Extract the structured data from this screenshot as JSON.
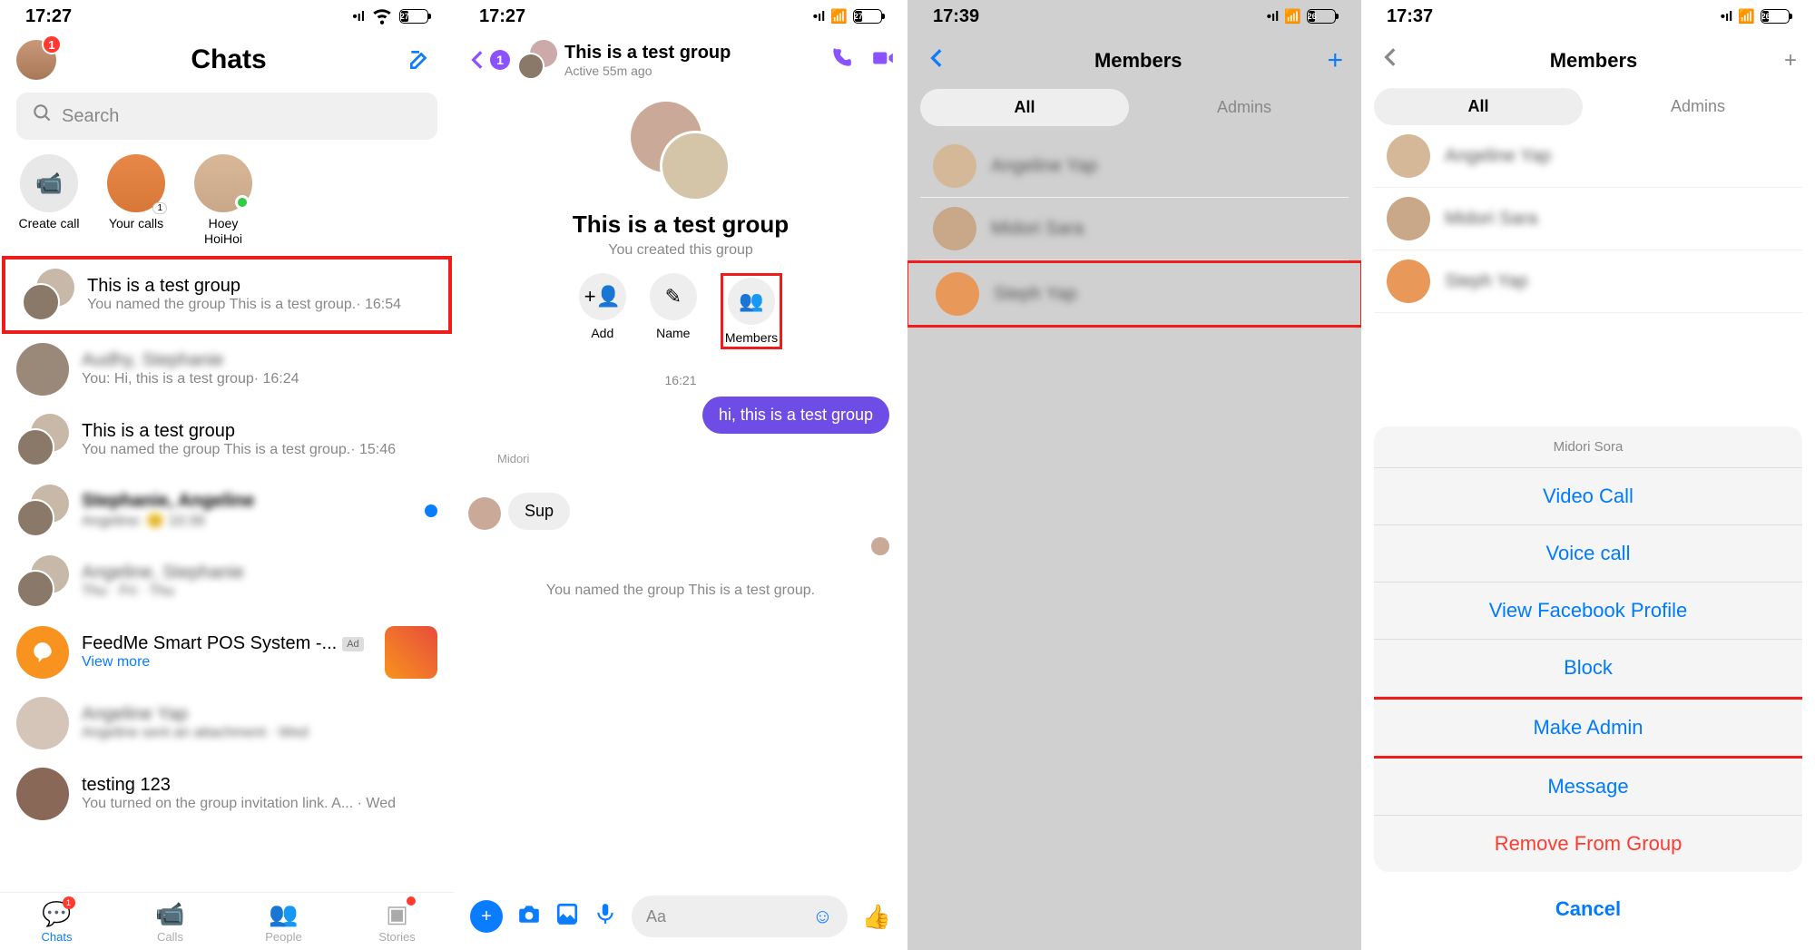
{
  "panel1": {
    "time": "17:27",
    "battery": "27",
    "avatar_badge": "1",
    "title": "Chats",
    "search_placeholder": "Search",
    "stories": [
      {
        "label": "Create call"
      },
      {
        "label": "Your calls",
        "count": "1"
      },
      {
        "label": "Hoey HoiHoi",
        "online": true
      }
    ],
    "chats": [
      {
        "name": "This is a test group",
        "sub": "You named the group This is a test group.· 16:54",
        "highlight": true
      },
      {
        "name": "Audhy, Stephanie",
        "sub": "You: Hi, this is a test group· 16:24",
        "blurred": true
      },
      {
        "name": "This is a test group",
        "sub": "You named the group This is a test group.· 15:46"
      },
      {
        "name": "Stephanie, Angeline",
        "sub": "Angeline: 😊 10:39",
        "unread": true,
        "blurred": true
      },
      {
        "name": "Angeline, Stephanie",
        "sub": "Thu · Fri · Thu",
        "blurred": true
      }
    ],
    "ad": {
      "title": "FeedMe Smart POS System -...",
      "badge": "Ad",
      "view_more": "View more"
    },
    "more_chats": [
      {
        "name": "Angeline Yap",
        "sub": "Angeline sent an attachment · Wed",
        "blurred": true
      },
      {
        "name": "testing 123",
        "sub": "You turned on the group invitation link. A... · Wed"
      }
    ],
    "nav": [
      {
        "label": "Chats",
        "badge": "1",
        "active": true
      },
      {
        "label": "Calls"
      },
      {
        "label": "People"
      },
      {
        "label": "Stories",
        "dot": true
      }
    ]
  },
  "panel2": {
    "time": "17:27",
    "battery": "27",
    "back_badge": "1",
    "title": "This is a test group",
    "subtitle": "Active 55m ago",
    "hero_title": "This is a test group",
    "hero_sub": "You created this group",
    "actions": [
      {
        "label": "Add"
      },
      {
        "label": "Name"
      },
      {
        "label": "Members",
        "highlight": true
      }
    ],
    "timestamp": "16:21",
    "msg_out": "hi, this is a test group",
    "msg_in_name": "Midori",
    "msg_in": "Sup",
    "sys_msg": "You named the group This is a test group.",
    "input_placeholder": "Aa"
  },
  "panel3": {
    "time": "17:39",
    "battery": "26",
    "title": "Members",
    "segments": [
      {
        "label": "All",
        "active": true
      },
      {
        "label": "Admins"
      }
    ],
    "members": [
      {
        "name": "Angeline Yap"
      },
      {
        "name": "Midori Sara"
      },
      {
        "name": "Steph Yap",
        "highlight": true
      }
    ]
  },
  "panel4": {
    "time": "17:37",
    "battery": "26",
    "title": "Members",
    "segments": [
      {
        "label": "All",
        "active": true
      },
      {
        "label": "Admins"
      }
    ],
    "members": [
      {
        "name": "Angeline Yap"
      },
      {
        "name": "Midori Sara"
      },
      {
        "name": "Steph Yap"
      }
    ],
    "sheet": {
      "header": "Midori Sora",
      "items": [
        {
          "label": "Video Call"
        },
        {
          "label": "Voice call"
        },
        {
          "label": "View Facebook Profile"
        },
        {
          "label": "Block"
        },
        {
          "label": "Make Admin",
          "highlight": true
        },
        {
          "label": "Message"
        },
        {
          "label": "Remove From Group",
          "danger": true
        }
      ],
      "cancel": "Cancel"
    }
  }
}
